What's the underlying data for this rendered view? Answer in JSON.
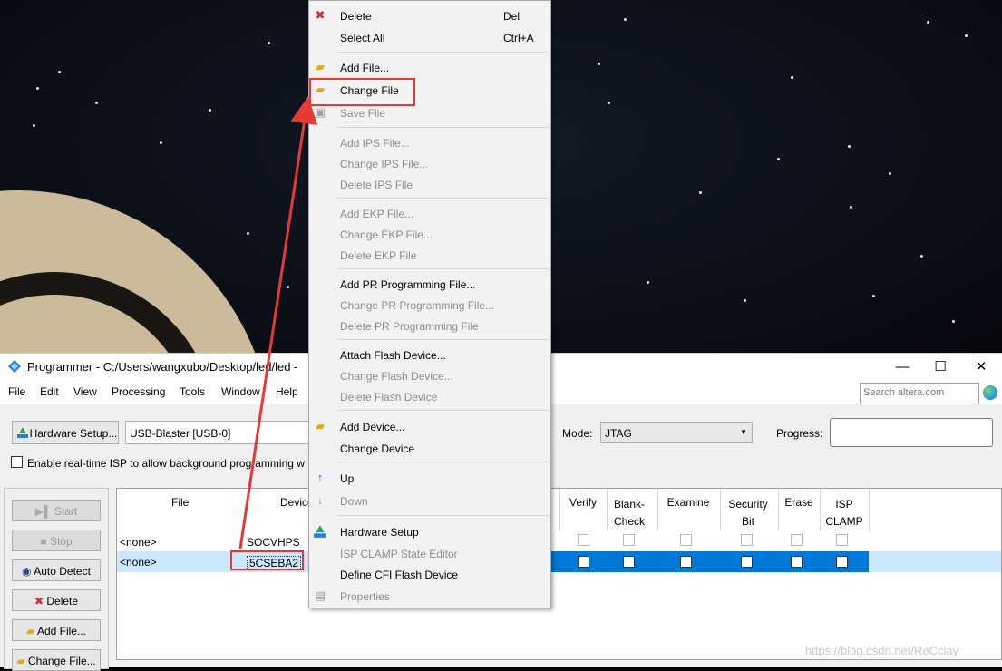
{
  "window": {
    "title": "Programmer - C:/Users/wangxubo/Desktop/led/led -",
    "controls": {
      "minimize": "—",
      "maximize": "☐",
      "close": "✕"
    }
  },
  "menubar": [
    "File",
    "Edit",
    "View",
    "Processing",
    "Tools",
    "Window",
    "Help"
  ],
  "search": {
    "placeholder": "Search altera.com"
  },
  "toolbar": {
    "hardware_setup_label": "Hardware Setup...",
    "hardware_value": "USB-Blaster [USB-0]",
    "mode_label": "Mode:",
    "mode_value": "JTAG",
    "progress_label": "Progress:",
    "isp_label": "Enable real-time ISP to allow background programming w"
  },
  "side_buttons": [
    {
      "label": "Start",
      "disabled": true
    },
    {
      "label": "Stop",
      "disabled": true
    },
    {
      "label": "Auto Detect",
      "disabled": false
    },
    {
      "label": "Delete",
      "disabled": false
    },
    {
      "label": "Add File...",
      "disabled": false
    },
    {
      "label": "Change File...",
      "disabled": false
    }
  ],
  "grid": {
    "headers": {
      "file": "File",
      "device": "Device",
      "verify": "Verify",
      "blank_check": "Blank-\nCheck",
      "examine": "Examine",
      "security_bit": "Security\nBit",
      "erase": "Erase",
      "isp_clamp": "ISP\nCLAMP"
    },
    "rows": [
      {
        "file": "<none>",
        "device": "SOCVHPS"
      },
      {
        "file": "<none>",
        "device": "5CSEBA2"
      }
    ]
  },
  "context_menu": {
    "items": [
      {
        "label": "Delete",
        "shortcut": "Del",
        "disabled": false,
        "icon": "red-x-icon"
      },
      {
        "label": "Select All",
        "shortcut": "Ctrl+A",
        "disabled": false
      },
      {
        "label": "Add File...",
        "disabled": false,
        "icon": "folder-icon"
      },
      {
        "label": "Change File",
        "disabled": false,
        "icon": "change-file-icon"
      },
      {
        "label": "Save File",
        "disabled": true,
        "icon": "save-icon"
      },
      {
        "label": "Add IPS File...",
        "disabled": true
      },
      {
        "label": "Change IPS File...",
        "disabled": true
      },
      {
        "label": "Delete IPS File",
        "disabled": true
      },
      {
        "label": "Add EKP File...",
        "disabled": true
      },
      {
        "label": "Change EKP File...",
        "disabled": true
      },
      {
        "label": "Delete EKP File",
        "disabled": true
      },
      {
        "label": "Add PR Programming File...",
        "disabled": false
      },
      {
        "label": "Change PR Programming File...",
        "disabled": true
      },
      {
        "label": "Delete PR Programming File",
        "disabled": true
      },
      {
        "label": "Attach Flash Device...",
        "disabled": false
      },
      {
        "label": "Change Flash Device...",
        "disabled": true
      },
      {
        "label": "Delete Flash Device",
        "disabled": true
      },
      {
        "label": "Add Device...",
        "disabled": false,
        "icon": "add-device-icon"
      },
      {
        "label": "Change Device",
        "disabled": false
      },
      {
        "label": "Up",
        "disabled": false,
        "icon": "up-arrow-icon"
      },
      {
        "label": "Down",
        "disabled": true,
        "icon": "down-arrow-icon"
      },
      {
        "label": "Hardware Setup",
        "disabled": false,
        "icon": "hardware-icon"
      },
      {
        "label": "ISP CLAMP State Editor",
        "disabled": true
      },
      {
        "label": "Define CFI Flash Device",
        "disabled": false
      },
      {
        "label": "Properties",
        "disabled": true,
        "icon": "properties-icon"
      }
    ]
  },
  "watermark": "https://blog.csdn.net/ReCclay",
  "colors": {
    "annotation_red": "#e53935",
    "selected_row": "#cce8ff"
  }
}
